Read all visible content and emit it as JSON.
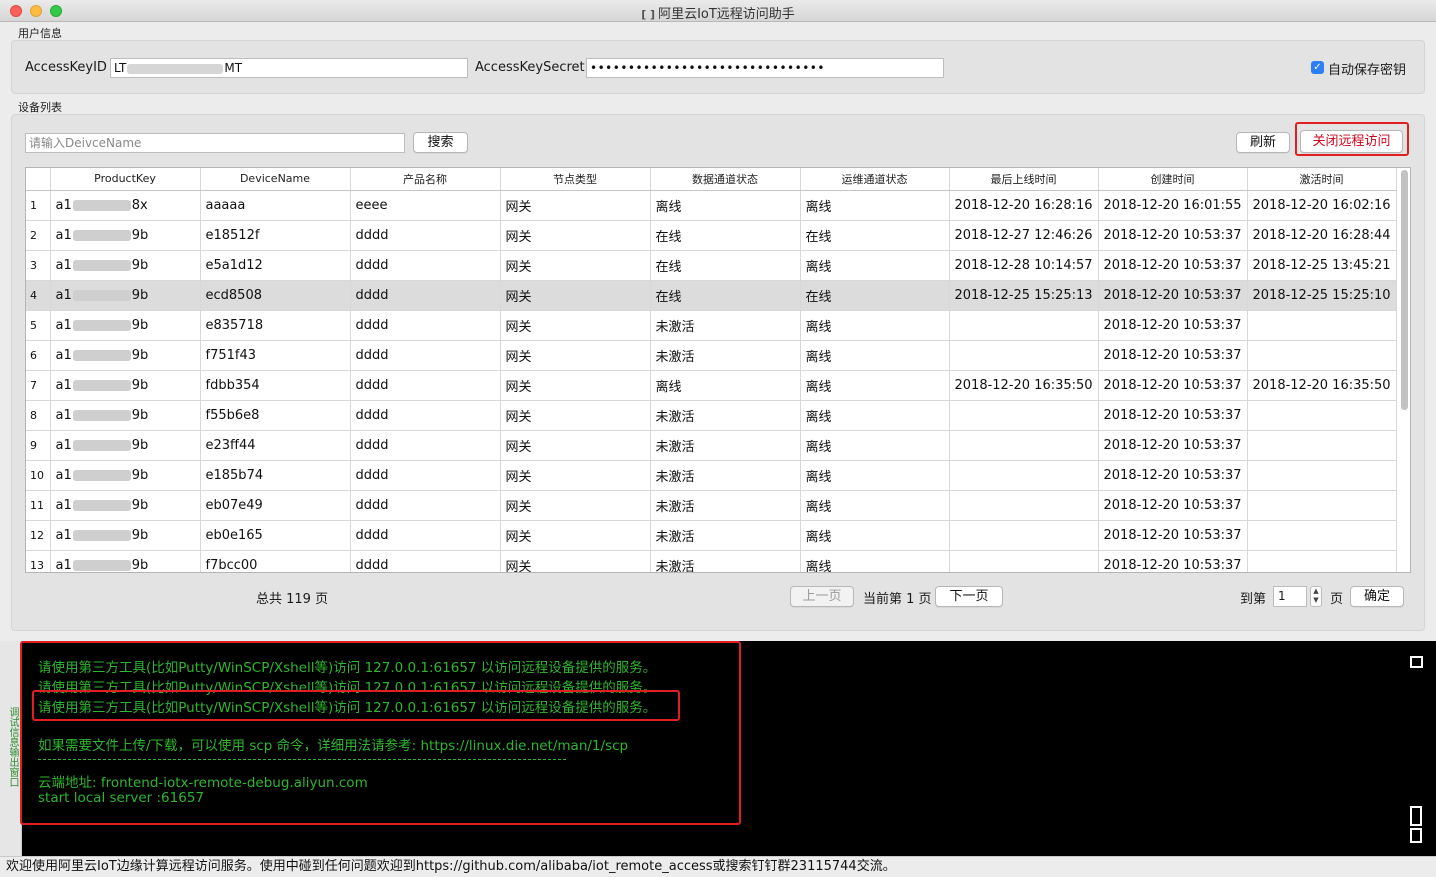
{
  "window": {
    "title": "阿里云IoT远程访问助手",
    "icon": "cloud-bracket-icon"
  },
  "user_info": {
    "group_label": "用户信息",
    "access_key_id_label": "AccessKeyID",
    "access_key_id_prefix": "LT",
    "access_key_id_suffix": "MT",
    "access_key_secret_label": "AccessKeySecret",
    "access_key_secret_value": "•••••••••••••••••••••••••••••••",
    "auto_save_label": "自动保存密钥",
    "auto_save_checked": true
  },
  "device_list": {
    "group_label": "设备列表",
    "search_placeholder": "请输入DeivceName",
    "search_button": "搜索",
    "refresh_button": "刷新",
    "close_remote_button": "关闭远程访问",
    "columns": [
      "",
      "ProductKey",
      "DeviceName",
      "产品名称",
      "节点类型",
      "数据通道状态",
      "运维通道状态",
      "最后上线时间",
      "创建时间",
      "激活时间"
    ],
    "rows": [
      {
        "idx": "1",
        "pk_prefix": "a1",
        "pk_suffix": "8x",
        "name": "aaaaa",
        "product": "eeee",
        "node": "网关",
        "data": "离线",
        "ops": "离线",
        "last": "2018-12-20 16:28:16",
        "created": "2018-12-20 16:01:55",
        "activated": "2018-12-20 16:02:16"
      },
      {
        "idx": "2",
        "pk_prefix": "a1",
        "pk_suffix": "9b",
        "name": "e18512f",
        "product": "dddd",
        "node": "网关",
        "data": "在线",
        "ops": "在线",
        "last": "2018-12-27 12:46:26",
        "created": "2018-12-20 10:53:37",
        "activated": "2018-12-20 16:28:44"
      },
      {
        "idx": "3",
        "pk_prefix": "a1",
        "pk_suffix": "9b",
        "name": "e5a1d12",
        "product": "dddd",
        "node": "网关",
        "data": "在线",
        "ops": "离线",
        "last": "2018-12-28 10:14:57",
        "created": "2018-12-20 10:53:37",
        "activated": "2018-12-25 13:45:21"
      },
      {
        "idx": "4",
        "pk_prefix": "a1",
        "pk_suffix": "9b",
        "name": "ecd8508",
        "product": "dddd",
        "node": "网关",
        "data": "在线",
        "ops": "在线",
        "last": "2018-12-25 15:25:13",
        "created": "2018-12-20 10:53:37",
        "activated": "2018-12-25 15:25:10",
        "selected": true
      },
      {
        "idx": "5",
        "pk_prefix": "a1",
        "pk_suffix": "9b",
        "name": "e835718",
        "product": "dddd",
        "node": "网关",
        "data": "未激活",
        "ops": "离线",
        "last": "",
        "created": "2018-12-20 10:53:37",
        "activated": ""
      },
      {
        "idx": "6",
        "pk_prefix": "a1",
        "pk_suffix": "9b",
        "name": "f751f43",
        "product": "dddd",
        "node": "网关",
        "data": "未激活",
        "ops": "离线",
        "last": "",
        "created": "2018-12-20 10:53:37",
        "activated": ""
      },
      {
        "idx": "7",
        "pk_prefix": "a1",
        "pk_suffix": "9b",
        "name": "fdbb354",
        "product": "dddd",
        "node": "网关",
        "data": "离线",
        "ops": "离线",
        "last": "2018-12-20 16:35:50",
        "created": "2018-12-20 10:53:37",
        "activated": "2018-12-20 16:35:50"
      },
      {
        "idx": "8",
        "pk_prefix": "a1",
        "pk_suffix": "9b",
        "name": "f55b6e8",
        "product": "dddd",
        "node": "网关",
        "data": "未激活",
        "ops": "离线",
        "last": "",
        "created": "2018-12-20 10:53:37",
        "activated": ""
      },
      {
        "idx": "9",
        "pk_prefix": "a1",
        "pk_suffix": "9b",
        "name": "e23ff44",
        "product": "dddd",
        "node": "网关",
        "data": "未激活",
        "ops": "离线",
        "last": "",
        "created": "2018-12-20 10:53:37",
        "activated": ""
      },
      {
        "idx": "10",
        "pk_prefix": "a1",
        "pk_suffix": "9b",
        "name": "e185b74",
        "product": "dddd",
        "node": "网关",
        "data": "未激活",
        "ops": "离线",
        "last": "",
        "created": "2018-12-20 10:53:37",
        "activated": ""
      },
      {
        "idx": "11",
        "pk_prefix": "a1",
        "pk_suffix": "9b",
        "name": "eb07e49",
        "product": "dddd",
        "node": "网关",
        "data": "未激活",
        "ops": "离线",
        "last": "",
        "created": "2018-12-20 10:53:37",
        "activated": ""
      },
      {
        "idx": "12",
        "pk_prefix": "a1",
        "pk_suffix": "9b",
        "name": "eb0e165",
        "product": "dddd",
        "node": "网关",
        "data": "未激活",
        "ops": "离线",
        "last": "",
        "created": "2018-12-20 10:53:37",
        "activated": ""
      },
      {
        "idx": "13",
        "pk_prefix": "a1",
        "pk_suffix": "9b",
        "name": "f7bcc00",
        "product": "dddd",
        "node": "网关",
        "data": "未激活",
        "ops": "离线",
        "last": "",
        "created": "2018-12-20 10:53:37",
        "activated": ""
      }
    ]
  },
  "pagination": {
    "total_pages_text": "总共 119 页",
    "prev_button": "上一页",
    "current_text": "当前第 1 页",
    "next_button": "下一页",
    "goto_label": "到第",
    "goto_value": "1",
    "page_suffix": "页",
    "confirm_button": "确定"
  },
  "console": {
    "side_tab_label": "调试信息输出窗口",
    "lines": [
      "请使用第三方工具(比如Putty/WinSCP/Xshell等)访问 127.0.0.1:61657 以访问远程设备提供的服务。",
      "请使用第三方工具(比如Putty/WinSCP/Xshell等)访问 127.0.0.1:61657 以访问远程设备提供的服务。",
      "请使用第三方工具(比如Putty/WinSCP/Xshell等)访问 127.0.0.1:61657 以访问远程设备提供的服务。",
      "如果需要文件上传/下载，可以使用 scp 命令，详细用法请参考: https://linux.die.net/man/1/scp",
      "云端地址: frontend-iotx-remote-debug.aliyun.com",
      "start local server :61657"
    ],
    "text_color": "#2fb52f",
    "highlight_color": "#e02020"
  },
  "status_bar": {
    "text": "欢迎使用阿里云IoT边缘计算远程访问服务。使用中碰到任何问题欢迎到https://github.com/alibaba/iot_remote_access或搜索钉钉群23115744交流。"
  }
}
